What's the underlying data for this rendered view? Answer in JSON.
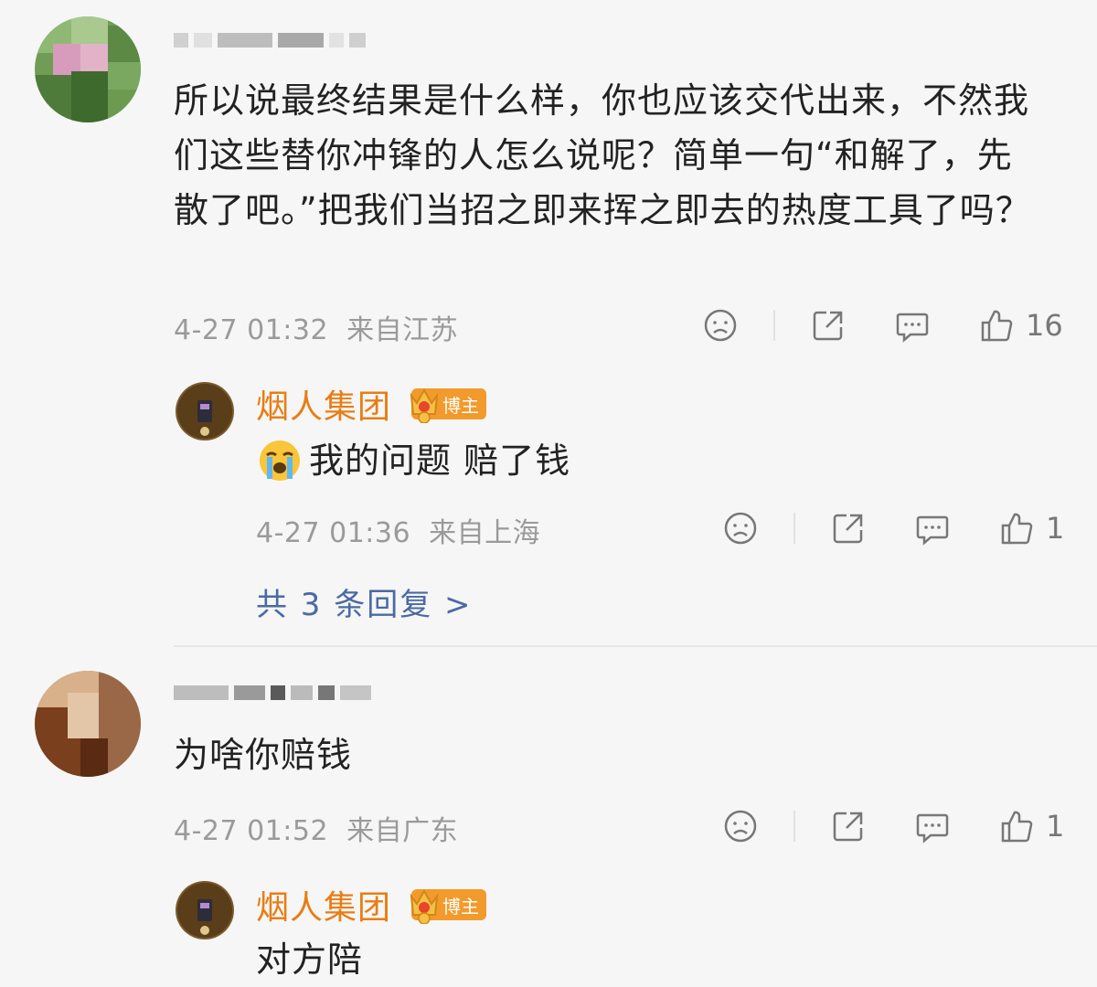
{
  "comments": [
    {
      "user_name": "",
      "text": "所以说最终结果是什么样，你也应该交代出来，不然我们这些替你冲锋的人怎么说呢？简单一句“和解了，先散了吧。”把我们当招之即来挥之即去的热度工具了吗？",
      "time": "4-27 01:32",
      "location": "来自江苏",
      "likes": "16",
      "reply": {
        "author": "烟人集团",
        "badge": "博主",
        "emoji": "😭",
        "text": "我的问题 赔了钱",
        "time": "4-27 01:36",
        "location": "来自上海",
        "likes": "1"
      },
      "reply_summary": "共 3 条回复 >"
    },
    {
      "user_name": "",
      "text": "为啥你赔钱",
      "time": "4-27 01:52",
      "location": "来自广东",
      "likes": "1",
      "reply": {
        "author": "烟人集团",
        "badge": "博主",
        "text": "对方陪"
      }
    }
  ],
  "icons": [
    "sad-face-icon",
    "share-icon",
    "comment-icon",
    "thumbs-up-icon"
  ],
  "colors": {
    "author": "#e87d14",
    "badge": "#f29a2b",
    "link": "#4a6aa3",
    "meta": "#9a9a9a"
  }
}
